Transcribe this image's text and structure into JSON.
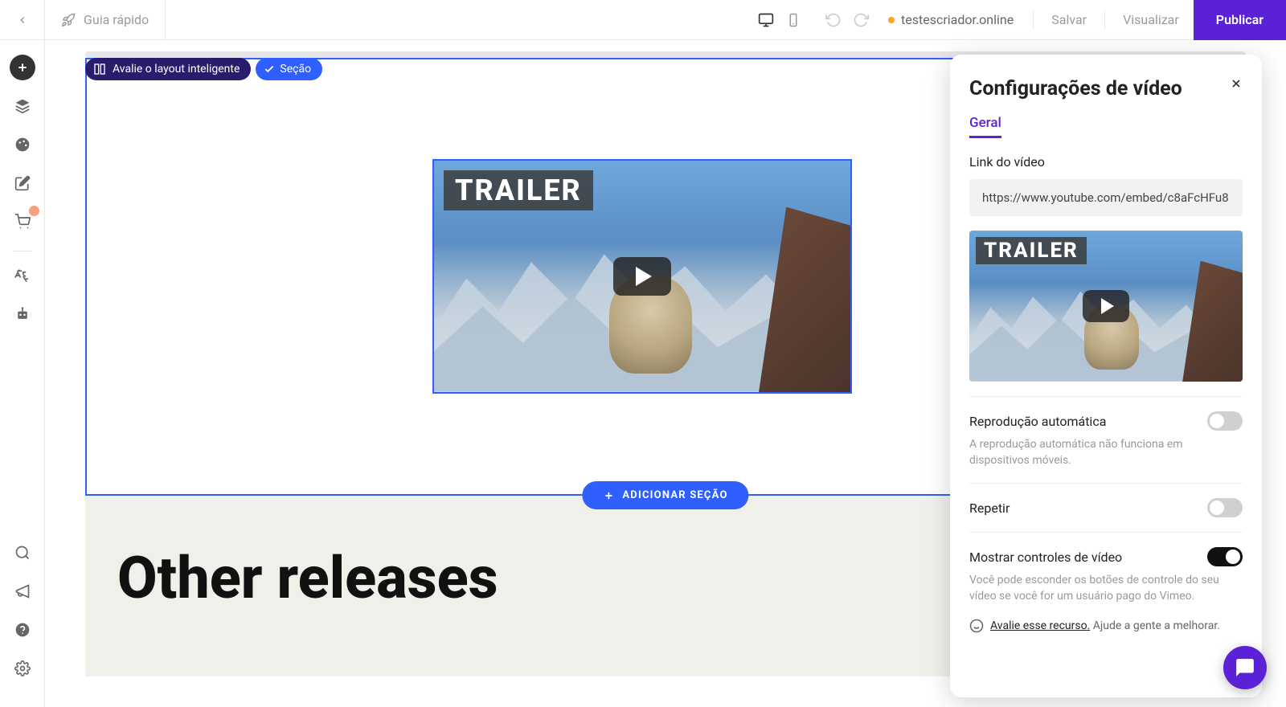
{
  "topbar": {
    "quick_guide": "Guia rápido",
    "site_name": "testescriador.online",
    "save": "Salvar",
    "preview": "Visualizar",
    "publish": "Publicar"
  },
  "badges": {
    "smart_layout": "Avalie o layout inteligente",
    "section": "Seção"
  },
  "video": {
    "trailer_label": "TRAILER"
  },
  "add_section": "ADICIONAR SEÇÃO",
  "other_releases": "Other releases",
  "panel": {
    "title": "Configurações de vídeo",
    "tab_general": "Geral",
    "link_label": "Link do vídeo",
    "link_value": "https://www.youtube.com/embed/c8aFcHFu8",
    "autoplay": {
      "label": "Reprodução automática",
      "desc": "A reprodução automática não funciona em dispositivos móveis.",
      "enabled": false
    },
    "repeat": {
      "label": "Repetir",
      "enabled": false
    },
    "controls": {
      "label": "Mostrar controles de vídeo",
      "desc": "Você pode esconder os botões de controle do seu vídeo se você for um usuário pago do Vimeo.",
      "enabled": true
    },
    "feedback": {
      "link": "Avalie esse recurso.",
      "text": "Ajude a gente a melhorar."
    }
  }
}
